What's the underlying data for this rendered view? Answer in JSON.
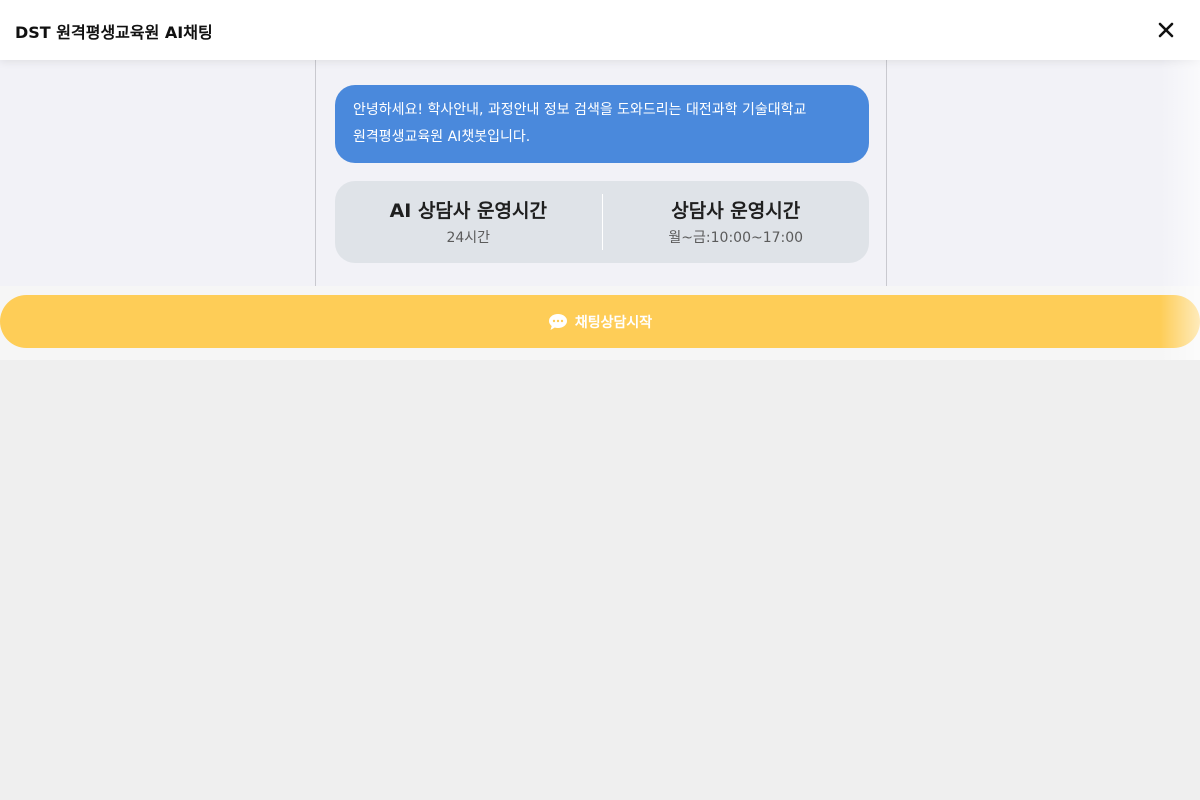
{
  "header": {
    "title": "DST 원격평생교육원 AI채팅",
    "close_icon": "close-icon"
  },
  "chat": {
    "greeting_line1": "안녕하세요! 학사안내, 과정안내 정보 검색을 도와드리는 대전과학 기술대학교",
    "greeting_line2": "원격평생교육원 AI챗봇입니다."
  },
  "hours": {
    "ai": {
      "label": "AI 상담사 운영시간",
      "value": "24시간"
    },
    "human": {
      "label": "상담사 운영시간",
      "value": "월~금:10:00~17:00"
    }
  },
  "start": {
    "label": "채팅상담시작",
    "icon": "chat-bubble-icon"
  },
  "colors": {
    "bubble": "#4a89dc",
    "button": "#fecd57",
    "card": "#dfe3e8"
  }
}
